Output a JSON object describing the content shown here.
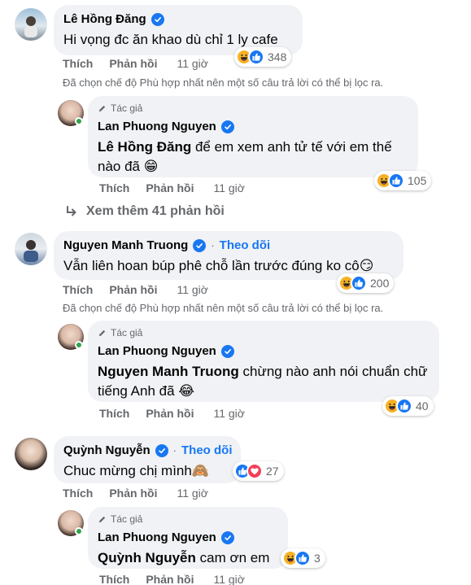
{
  "comments": [
    {
      "author": "Lê Hồng Đăng",
      "text": "Hi vọng đc ăn khao dù chỉ 1 ly cafe",
      "like": "Thích",
      "reply": "Phản hồi",
      "time": "11 giờ",
      "reaction_count": "348",
      "filter_note": "Đã chọn chế độ Phù hợp nhất nên một số câu trả lời có thể bị lọc ra.",
      "reply_item": {
        "tag": "Tác giả",
        "author": "Lan Phuong Nguyen",
        "mention": "Lê Hồng Đăng",
        "text": " để em xem anh tử tế với em thế nào đã 😁",
        "like": "Thích",
        "reply": "Phản hồi",
        "time": "11 giờ",
        "reaction_count": "105"
      },
      "more_replies": "Xem thêm 41 phản hồi"
    },
    {
      "author": "Nguyen Manh Truong",
      "separator": "·",
      "follow": "Theo dõi",
      "text": "Vẫn liên hoan búp phê chỗ lần trước đúng ko cô😏",
      "like": "Thích",
      "reply": "Phản hồi",
      "time": "11 giờ",
      "reaction_count": "200",
      "filter_note": "Đã chọn chế độ Phù hợp nhất nên một số câu trả lời có thể bị lọc ra.",
      "reply_item": {
        "tag": "Tác giả",
        "author": "Lan Phuong Nguyen",
        "mention": "Nguyen Manh Truong",
        "text": " chừng nào anh nói chuẩn chữ tiếng Anh đã 😂",
        "like": "Thích",
        "reply": "Phản hồi",
        "time": "11 giờ",
        "reaction_count": "40"
      }
    },
    {
      "author": "Quỳnh Nguyễn",
      "separator": "·",
      "follow": "Theo dõi",
      "text": "Chuc mừng chị mình🙈",
      "like": "Thích",
      "reply": "Phản hồi",
      "time": "11 giờ",
      "reaction_count": "27",
      "reply_item": {
        "tag": "Tác giả",
        "author": "Lan Phuong Nguyen",
        "mention": "Quỳnh Nguyễn",
        "text": " cam ơn em",
        "like": "Thích",
        "reply": "Phản hồi",
        "time": "11 giờ",
        "reaction_count": "3"
      }
    }
  ],
  "colors": {
    "like": "#1877f2",
    "haha": "#f7b125",
    "love": "#f33e58",
    "bubble": "#f0f2f5",
    "muted": "#65676b"
  }
}
